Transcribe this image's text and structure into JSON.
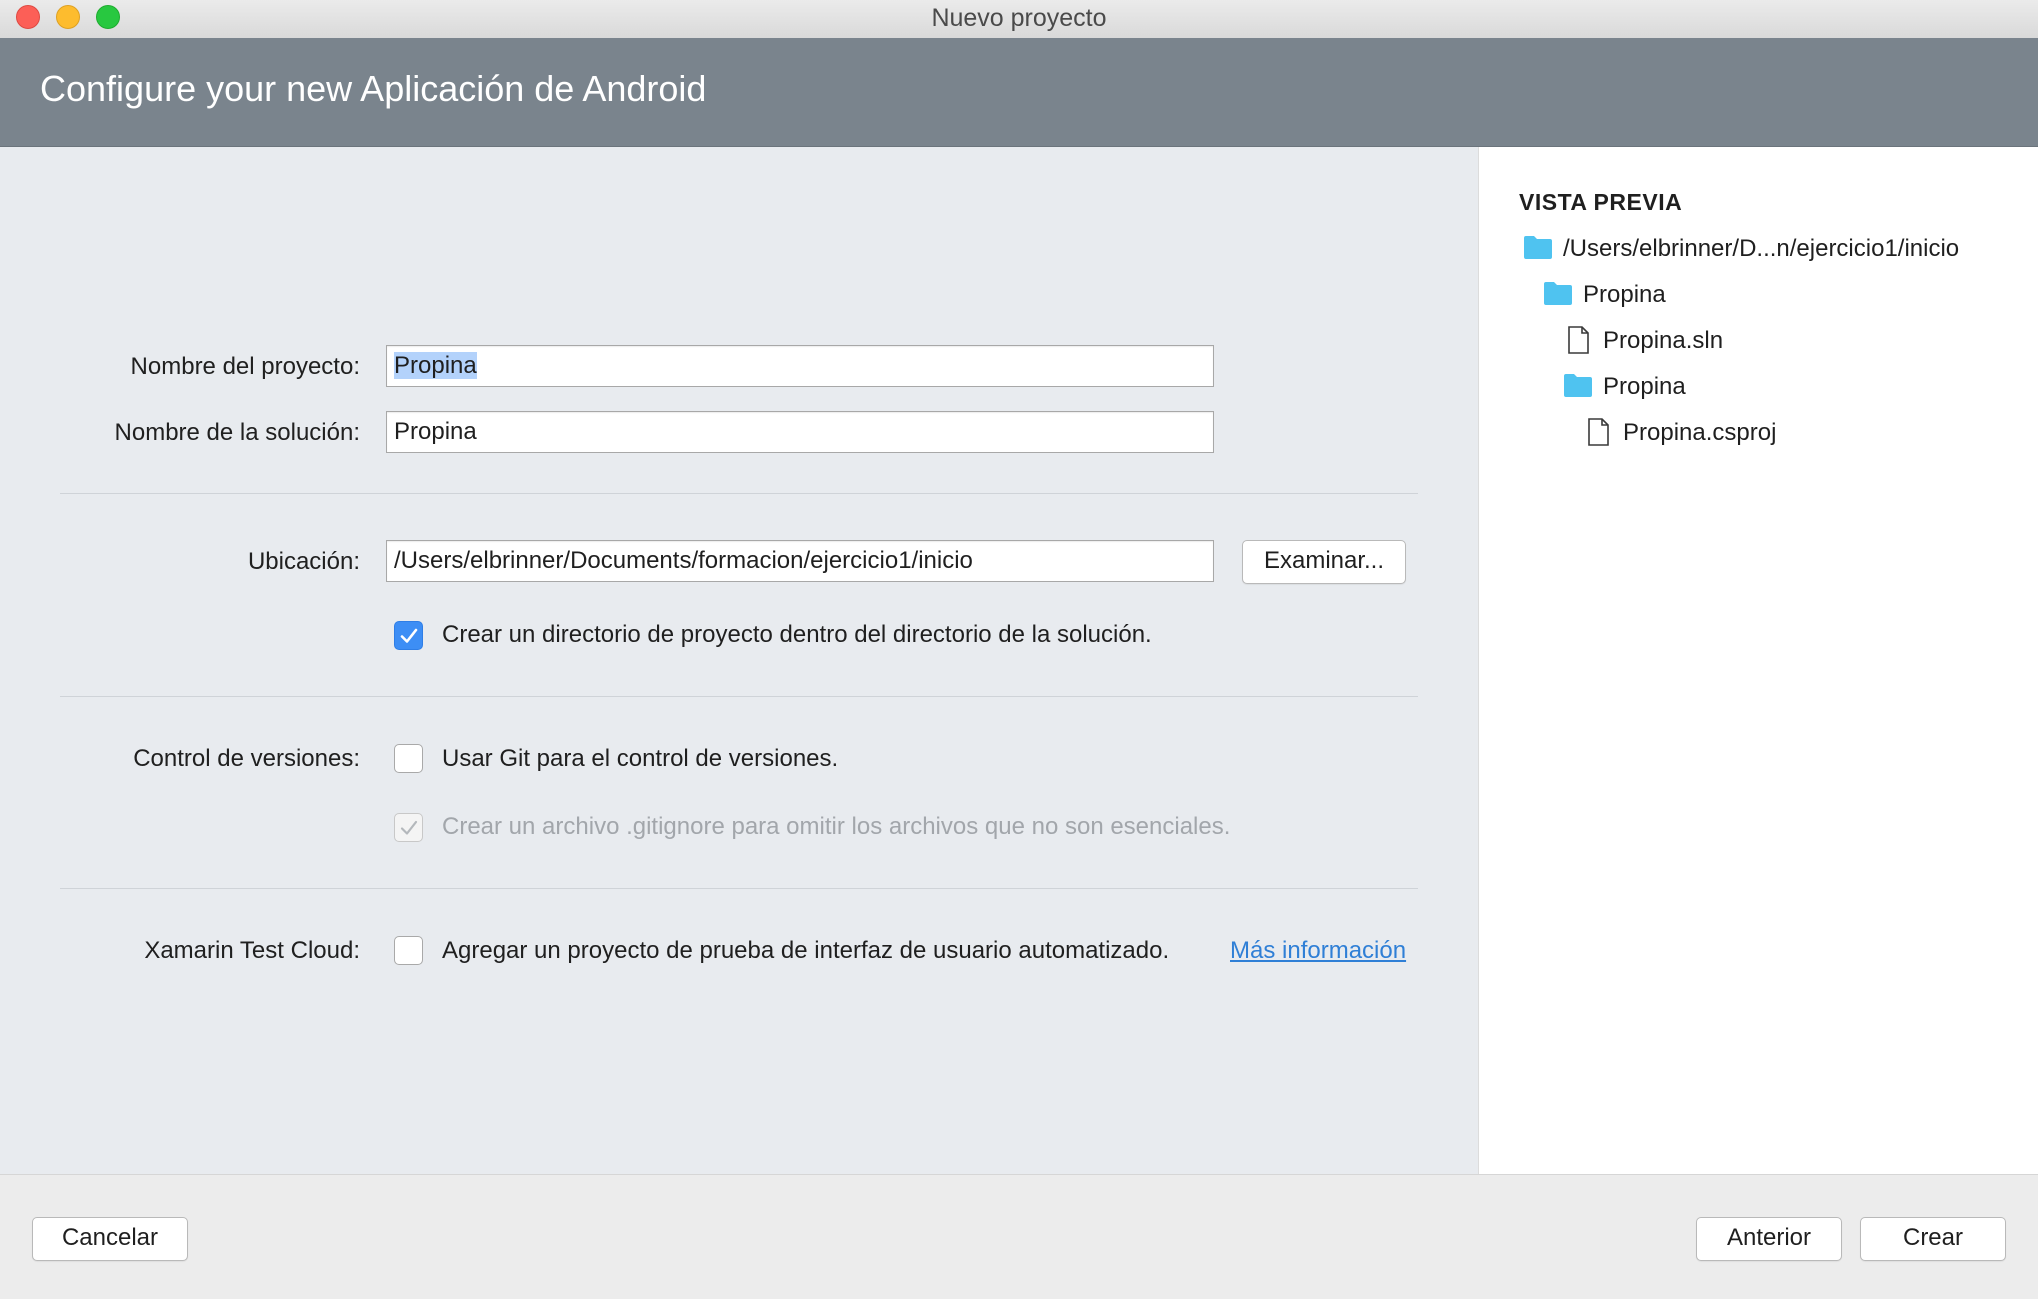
{
  "window": {
    "title": "Nuevo proyecto"
  },
  "header": {
    "title": "Configure your new Aplicación de Android"
  },
  "form": {
    "project_name": {
      "label": "Nombre del proyecto:",
      "value": "Propina"
    },
    "solution_name": {
      "label": "Nombre de la solución:",
      "value": "Propina"
    },
    "location": {
      "label": "Ubicación:",
      "value": "/Users/elbrinner/Documents/formacion/ejercicio1/inicio",
      "browse_label": "Examinar..."
    },
    "create_project_dir": {
      "label": "Crear un directorio de proyecto dentro del directorio de la solución.",
      "checked": true
    },
    "version_control": {
      "label": "Control de versiones:",
      "use_git": {
        "label": "Usar Git para el control de versiones.",
        "checked": false
      },
      "gitignore": {
        "label": "Crear un archivo .gitignore para omitir los archivos que no son esenciales.",
        "checked": true,
        "enabled": false
      }
    },
    "test_cloud": {
      "label": "Xamarin Test Cloud:",
      "option": {
        "label": "Agregar un proyecto de prueba de interfaz de usuario automatizado.",
        "checked": false
      },
      "more_info": "Más información"
    }
  },
  "preview": {
    "title": "VISTA PREVIA",
    "tree": [
      {
        "type": "folder",
        "label": "/Users/elbrinner/D...n/ejercicio1/inicio",
        "depth": 0
      },
      {
        "type": "folder",
        "label": "Propina",
        "depth": 1
      },
      {
        "type": "file",
        "label": "Propina.sln",
        "depth": 2
      },
      {
        "type": "folder",
        "label": "Propina",
        "depth": 2
      },
      {
        "type": "file",
        "label": "Propina.csproj",
        "depth": 3
      }
    ]
  },
  "footer": {
    "cancel": "Cancelar",
    "back": "Anterior",
    "create": "Crear"
  },
  "colors": {
    "accent": "#3d8ef5",
    "header_bg": "#7a848d",
    "folder": "#4fc3f0",
    "link": "#2f7fd6"
  }
}
